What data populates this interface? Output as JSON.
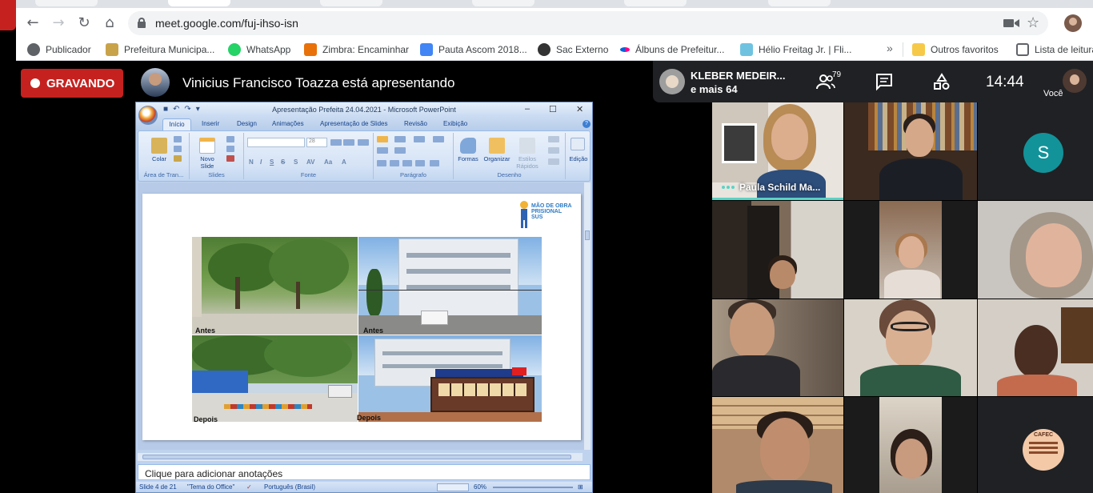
{
  "browser": {
    "url": "meet.google.com/fuj-ihso-isn",
    "bookmarks": [
      {
        "label": "Publicador"
      },
      {
        "label": "Prefeitura Municipa..."
      },
      {
        "label": "WhatsApp"
      },
      {
        "label": "Zimbra: Encaminhar"
      },
      {
        "label": "Pauta Ascom 2018..."
      },
      {
        "label": "Sac Externo"
      },
      {
        "label": "Álbuns de Prefeitur..."
      },
      {
        "label": "Hélio Freitag Jr. | Fli..."
      }
    ],
    "bookmarks_more": "»",
    "other_favorites": "Outros favoritos",
    "reading_list": "Lista de leitura"
  },
  "meet": {
    "recording_label": "GRAVANDO",
    "presenting_text": "Vinicius Francisco Toazza está apresentando",
    "pinned_name": "KLEBER MEDEIR...",
    "pinned_more": "e mais 64",
    "people_count": "79",
    "clock": "14:44",
    "self_label": "Você",
    "tiles": [
      {
        "name": "Paula Schild Ma...",
        "speaking": true
      },
      {
        "name": ""
      },
      {
        "initial": "S",
        "avatar_color": "#12939a"
      },
      {
        "name": ""
      },
      {
        "name": ""
      },
      {
        "name": ""
      },
      {
        "name": ""
      },
      {
        "name": ""
      },
      {
        "name": ""
      },
      {
        "name": ""
      },
      {
        "name": ""
      },
      {
        "logo_text": "CAFEC"
      }
    ]
  },
  "powerpoint": {
    "title": "Apresentação Prefeita 24.04.2021 - Microsoft PowerPoint",
    "tabs": [
      "Início",
      "Inserir",
      "Design",
      "Animações",
      "Apresentação de Slides",
      "Revisão",
      "Exibição"
    ],
    "groups": {
      "clipboard": "Área de Tran...",
      "slides": "Slides",
      "font": "Fonte",
      "paragraph": "Parágrafo",
      "drawing": "Desenho",
      "editing": "Edição"
    },
    "buttons": {
      "paste": "Colar",
      "new_slide_1": "Novo",
      "new_slide_2": "Slide",
      "shapes": "Formas",
      "arrange": "Organizar",
      "quick_styles_1": "Estilos",
      "quick_styles_2": "Rápidos",
      "editing": "Edição",
      "font_size": "28"
    },
    "slide": {
      "logo_text": "MÃO DE OBRA\nPRISIONAL\nSUS",
      "labels": [
        "Antes",
        "Antes",
        "Depois",
        "Depois"
      ]
    },
    "notes_placeholder": "Clique para adicionar anotações",
    "status": {
      "slide_info": "Slide 4 de 21",
      "theme": "\"Tema do Office\"",
      "language": "Português (Brasil)",
      "zoom": "60%"
    }
  }
}
